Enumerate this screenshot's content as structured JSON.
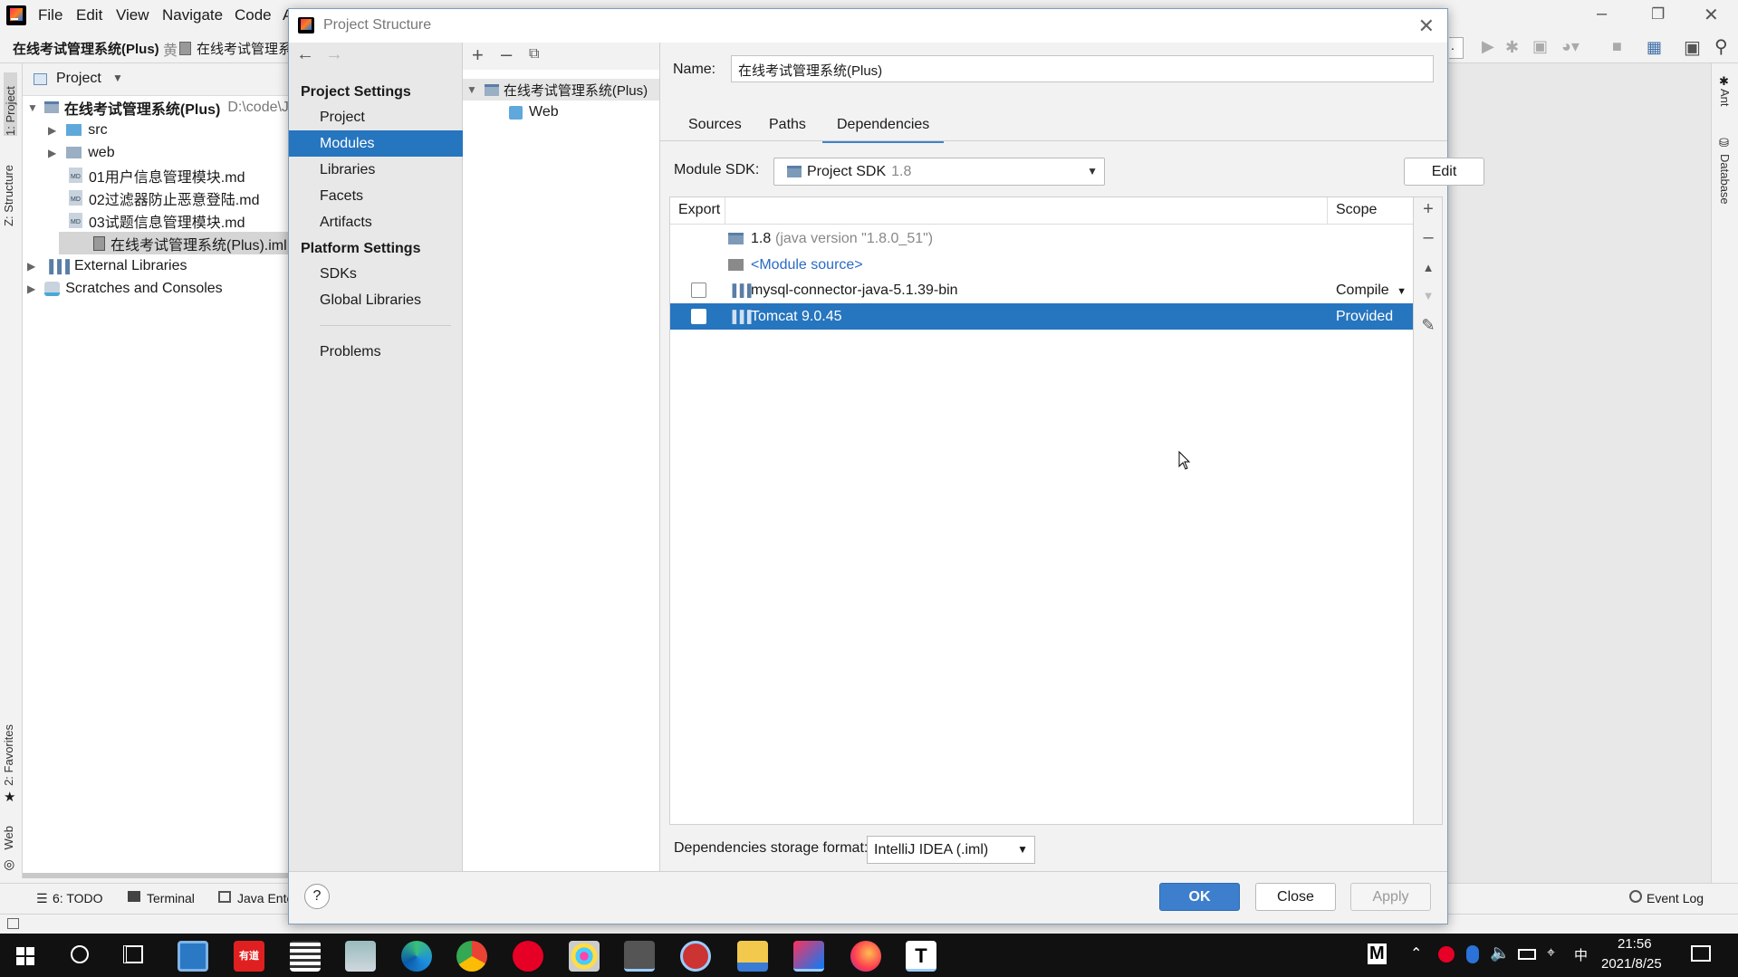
{
  "menu": {
    "file": "File",
    "edit": "Edit",
    "view": "View",
    "navigate": "Navigate",
    "code": "Code",
    "partial": "A"
  },
  "breadcrumb": {
    "project": "在线考试管理系统(Plus)",
    "file": "在线考试管理系"
  },
  "toolbar": {
    "run_config_partial": "."
  },
  "left_tabs": {
    "project": "1: Project",
    "structure": "Z: Structure",
    "favorites": "2: Favorites",
    "web": "Web"
  },
  "right_tabs": {
    "ant": "Ant",
    "database": "Database"
  },
  "project_panel": {
    "title": "Project",
    "root": {
      "name": "在线考试管理系统(Plus)",
      "path": "D:\\code\\J"
    },
    "items": [
      {
        "label": "src"
      },
      {
        "label": "web"
      },
      {
        "label": "01用户信息管理模块.md"
      },
      {
        "label": "02过滤器防止恶意登陆.md"
      },
      {
        "label": "03试题信息管理模块.md"
      },
      {
        "label": "在线考试管理系统(Plus).iml"
      }
    ],
    "external": "External Libraries",
    "scratches": "Scratches and Consoles"
  },
  "bottom_tabs": {
    "todo": "6: TODO",
    "terminal": "Terminal",
    "java_ent": "Java Ente",
    "event_log": "Event Log"
  },
  "dialog": {
    "title": "Project Structure",
    "project_settings_header": "Project Settings",
    "platform_settings_header": "Platform Settings",
    "categories": [
      "Project",
      "Modules",
      "Libraries",
      "Facets",
      "Artifacts"
    ],
    "platform_items": [
      "SDKs",
      "Global Libraries"
    ],
    "problems": "Problems",
    "module_tree": {
      "root": "在线考试管理系统(Plus)",
      "child": "Web"
    },
    "name_label": "Name:",
    "name_value": "在线考试管理系统(Plus)",
    "tabs": [
      "Sources",
      "Paths",
      "Dependencies"
    ],
    "module_sdk_label": "Module SDK:",
    "sdk_value": "Project SDK",
    "sdk_version": "1.8",
    "edit_button": "Edit",
    "table": {
      "col_export": "Export",
      "col_scope": "Scope",
      "rows": [
        {
          "name": "1.8",
          "detail": "(java version \"1.8.0_51\")",
          "scope": ""
        },
        {
          "name": "<Module source>",
          "detail": "",
          "scope": ""
        },
        {
          "name": "mysql-connector-java-5.1.39-bin",
          "detail": "",
          "scope": "Compile"
        },
        {
          "name": "Tomcat 9.0.45",
          "detail": "",
          "scope": "Provided"
        }
      ]
    },
    "storage_label": "Dependencies storage format:",
    "storage_value": "IntelliJ IDEA (.iml)",
    "help": "?",
    "ok": "OK",
    "close": "Close",
    "apply": "Apply"
  },
  "taskbar": {
    "time": "21:56",
    "date": "2021/8/25",
    "ime": "中",
    "m_icon": "M",
    "youdao": "有道",
    "t_app": "T"
  }
}
